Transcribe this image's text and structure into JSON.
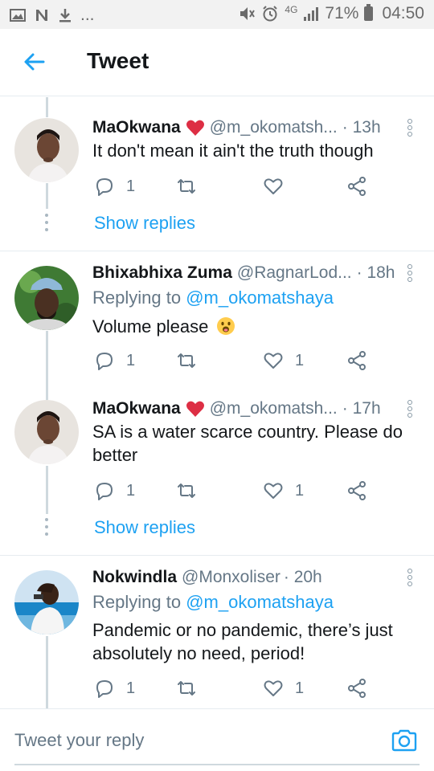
{
  "status_bar": {
    "left_icons": [
      "image-icon",
      "n-icon",
      "download-icon"
    ],
    "ellipsis": "...",
    "right_icons": [
      "mute-icon",
      "alarm-icon",
      "data-icon",
      "signal-icon"
    ],
    "network": "4G",
    "battery": "71%",
    "time": "04:50"
  },
  "header": {
    "title": "Tweet"
  },
  "tweets": [
    {
      "name": "MaOkwana",
      "handle": "@m_okomatsh...",
      "time": "· 13h",
      "replying_to": null,
      "text": "It don't mean it ain't the truth though",
      "replies": "1",
      "retweets": "",
      "likes": "",
      "show_replies": "Show replies"
    },
    {
      "name": "Bhixabhixa Zuma",
      "handle": "@RagnarLod...",
      "time": "· 18h",
      "replying_to_prefix": "Replying to",
      "replying_to": "@m_okomatshaya",
      "text": "Volume please",
      "replies": "1",
      "retweets": "",
      "likes": "1"
    },
    {
      "name": "MaOkwana",
      "handle": "@m_okomatsh...",
      "time": "· 17h",
      "text": "SA is a water scarce country. Please do better",
      "replies": "1",
      "retweets": "",
      "likes": "1",
      "show_replies": "Show replies"
    },
    {
      "name": "Nokwindla",
      "handle": "@Monxoliser",
      "time": "· 20h",
      "replying_to_prefix": "Replying to",
      "replying_to": "@m_okomatshaya",
      "text": "Pandemic or no pandemic, there’s just absolutely no need, period!",
      "replies": "1",
      "retweets": "",
      "likes": "1"
    }
  ],
  "composer": {
    "placeholder": "Tweet your reply"
  },
  "colors": {
    "accent": "#1da1f2",
    "muted": "#657786",
    "heart": "#e0245e"
  }
}
